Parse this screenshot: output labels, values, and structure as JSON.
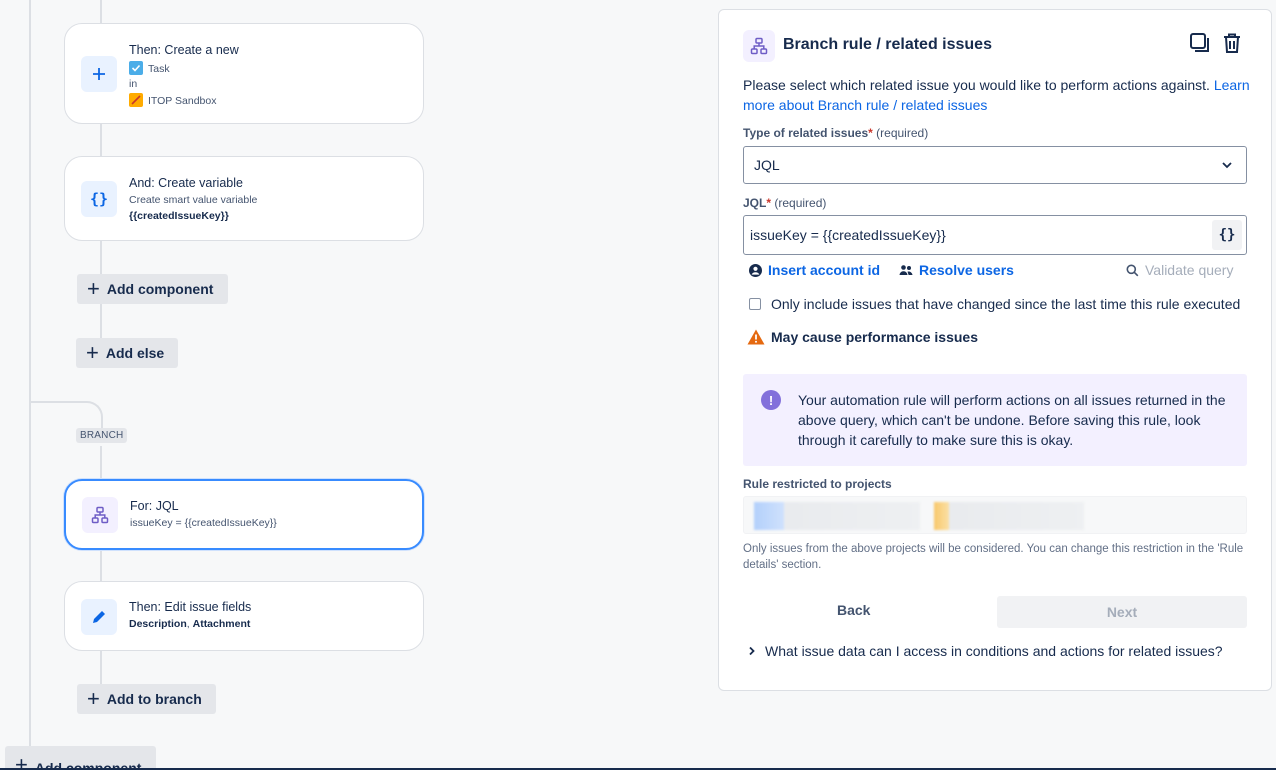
{
  "canvas": {
    "cards": [
      {
        "title": "Then: Create a new",
        "issue_type": "Task",
        "in_label": "in",
        "project": "ITOP Sandbox"
      },
      {
        "title": "And: Create variable",
        "sub": "Create smart value variable",
        "sub_bold": "{{createdIssueKey}}"
      },
      {
        "title": "For: JQL",
        "sub": "issueKey = {{createdIssueKey}}"
      },
      {
        "title": "Then: Edit issue fields",
        "sub_bold_1": "Description",
        "sep": ",",
        "sub_bold_2": "Attachment"
      }
    ],
    "add_component_label": "Add component",
    "add_else_label": "Add else",
    "branch_tag": "BRANCH",
    "add_to_branch_label": "Add to branch",
    "bottom_add_component_label": "Add component"
  },
  "panel": {
    "title": "Branch rule / related issues",
    "desc_text": "Please select which related issue you would like to perform actions against. ",
    "desc_link": "Learn more about Branch rule / related issues",
    "type_label": "Type of related issues",
    "required_star": "*",
    "required_text": "(required)",
    "type_value": "JQL",
    "jql_label": "JQL",
    "jql_value": "issueKey = {{createdIssueKey}}",
    "smart_btn": "{}",
    "insert_account_id": "Insert account id",
    "resolve_users": "Resolve users",
    "validate_query": "Validate query",
    "checkbox_label": "Only include issues that have changed since the last time this rule executed",
    "warning": "May cause performance issues",
    "info_text": "Your automation rule will perform actions on all issues returned in the above query, which can't be undone. Before saving this rule, look through it carefully to make sure this is okay.",
    "projects_label": "Rule restricted to projects",
    "projects_hint": "Only issues from the above projects will be considered. You can change this restriction in the 'Rule details' section.",
    "back": "Back",
    "next": "Next",
    "faq": "What issue data can I access in conditions and actions for related issues?"
  },
  "colors": {
    "accent": "#0c66e4",
    "selected_border": "#388bff",
    "info_bg": "#f3f0ff",
    "info_icon": "#8270db",
    "warning": "#e56910",
    "task_icon": "#4bade8",
    "project_icon": "#ffab00"
  }
}
